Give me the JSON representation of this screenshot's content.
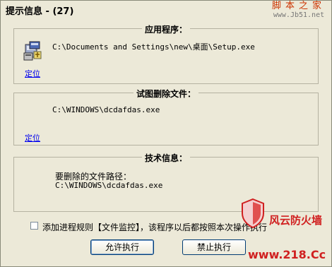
{
  "window": {
    "title": "提示信息 - (27)"
  },
  "watermark_top": {
    "text": "脚本之家",
    "url": "www.Jb51.net"
  },
  "app_section": {
    "legend": "应用程序：",
    "path": "C:\\Documents and Settings\\new\\桌面\\Setup.exe",
    "locate_link": "定位"
  },
  "delete_section": {
    "legend": "试图删除文件：",
    "path": "C:\\WINDOWS\\dcdafdas.exe",
    "locate_link": "定位"
  },
  "tech_section": {
    "legend": "技术信息：",
    "label": "要删除的文件路径：",
    "path": "C:\\WINDOWS\\dcdafdas.exe"
  },
  "rule_checkbox": {
    "label": "添加进程规则【文件监控】，该程序以后都按照本次操作执行",
    "checked": false
  },
  "buttons": {
    "allow": "允许执行",
    "block": "禁止执行"
  },
  "watermark_bottom": {
    "brand": "风云防火墙",
    "url": "www.218.Cc"
  }
}
